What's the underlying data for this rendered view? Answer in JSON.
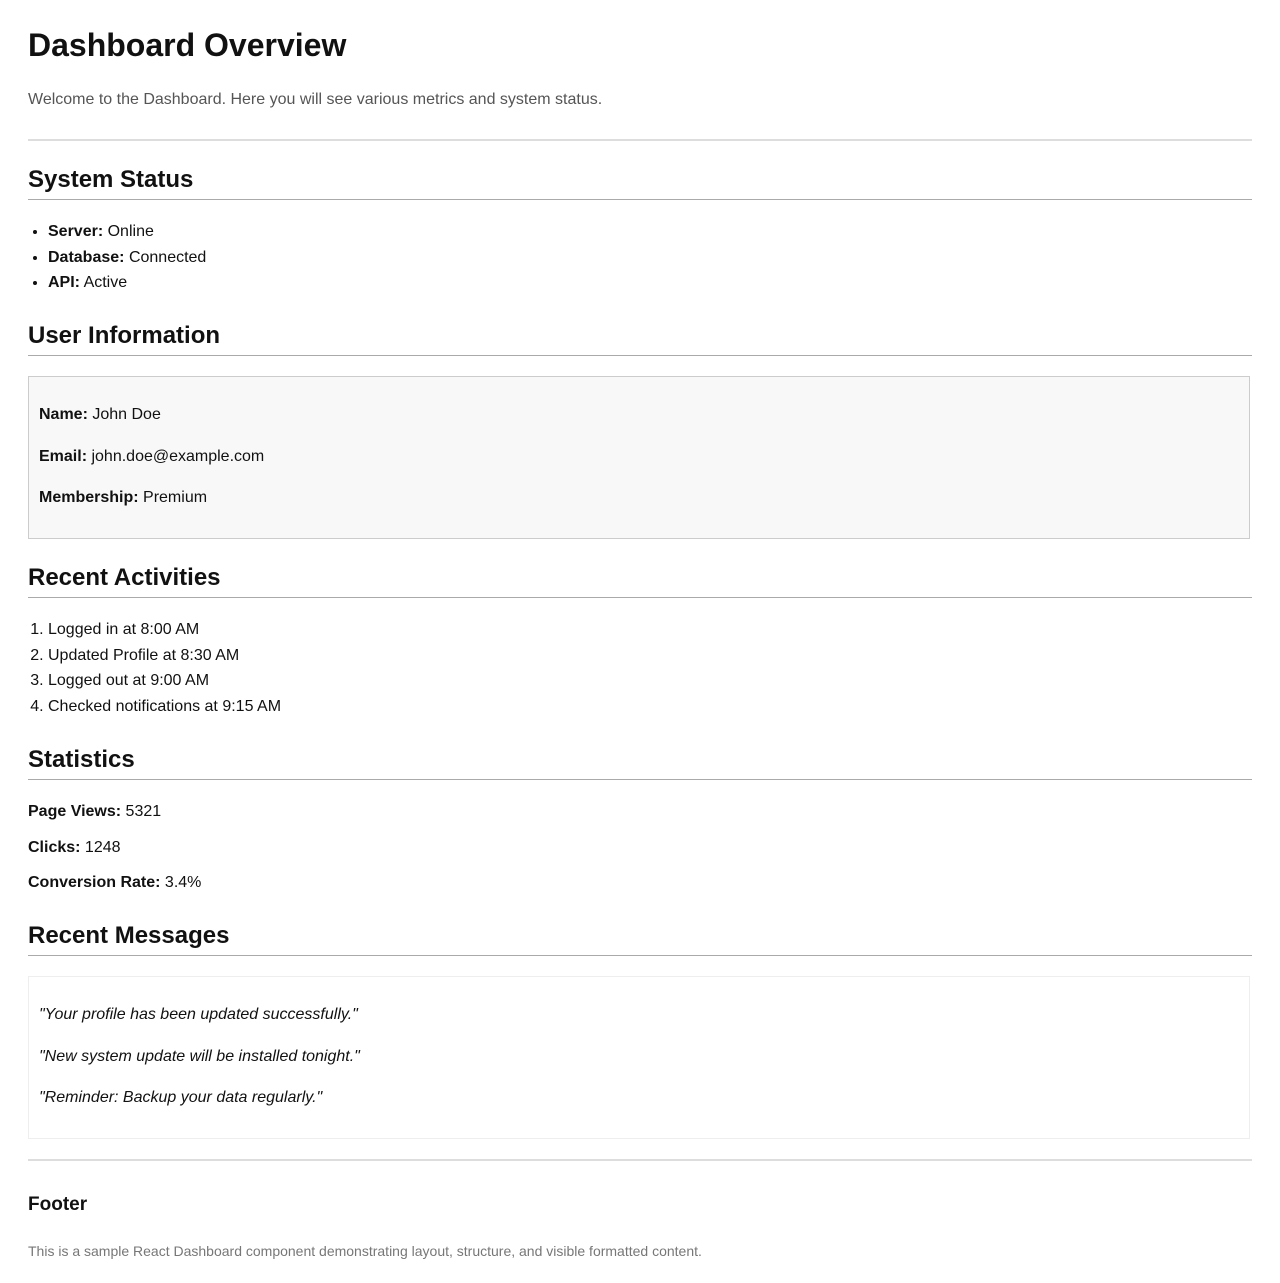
{
  "header": {
    "title": "Dashboard Overview",
    "intro": "Welcome to the Dashboard. Here you will see various metrics and system status."
  },
  "system_status": {
    "title": "System Status",
    "items": [
      {
        "label": "Server:",
        "value": "Online"
      },
      {
        "label": "Database:",
        "value": "Connected"
      },
      {
        "label": "API:",
        "value": "Active"
      }
    ]
  },
  "user_info": {
    "title": "User Information",
    "fields": [
      {
        "label": "Name:",
        "value": "John Doe"
      },
      {
        "label": "Email:",
        "value": "john.doe@example.com"
      },
      {
        "label": "Membership:",
        "value": "Premium"
      }
    ]
  },
  "recent_activities": {
    "title": "Recent Activities",
    "items": [
      "Logged in at 8:00 AM",
      "Updated Profile at 8:30 AM",
      "Logged out at 9:00 AM",
      "Checked notifications at 9:15 AM"
    ]
  },
  "statistics": {
    "title": "Statistics",
    "items": [
      {
        "label": "Page Views:",
        "value": "5321"
      },
      {
        "label": "Clicks:",
        "value": "1248"
      },
      {
        "label": "Conversion Rate:",
        "value": "3.4%"
      }
    ]
  },
  "recent_messages": {
    "title": "Recent Messages",
    "items": [
      "\"Your profile has been updated successfully.\"",
      "\"New system update will be installed tonight.\"",
      "\"Reminder: Backup your data regularly.\""
    ]
  },
  "footer": {
    "title": "Footer",
    "text": "This is a sample React Dashboard component demonstrating layout, structure, and visible formatted content."
  },
  "colors": {
    "text": "#111111",
    "muted_text": "#555555",
    "footer_text": "#777777",
    "divider": "#dddddd",
    "section_rule": "#aaaaaa",
    "user_box_bg": "#f8f8f8",
    "user_box_border": "#cccccc",
    "messages_box_border": "#eeeeee"
  }
}
